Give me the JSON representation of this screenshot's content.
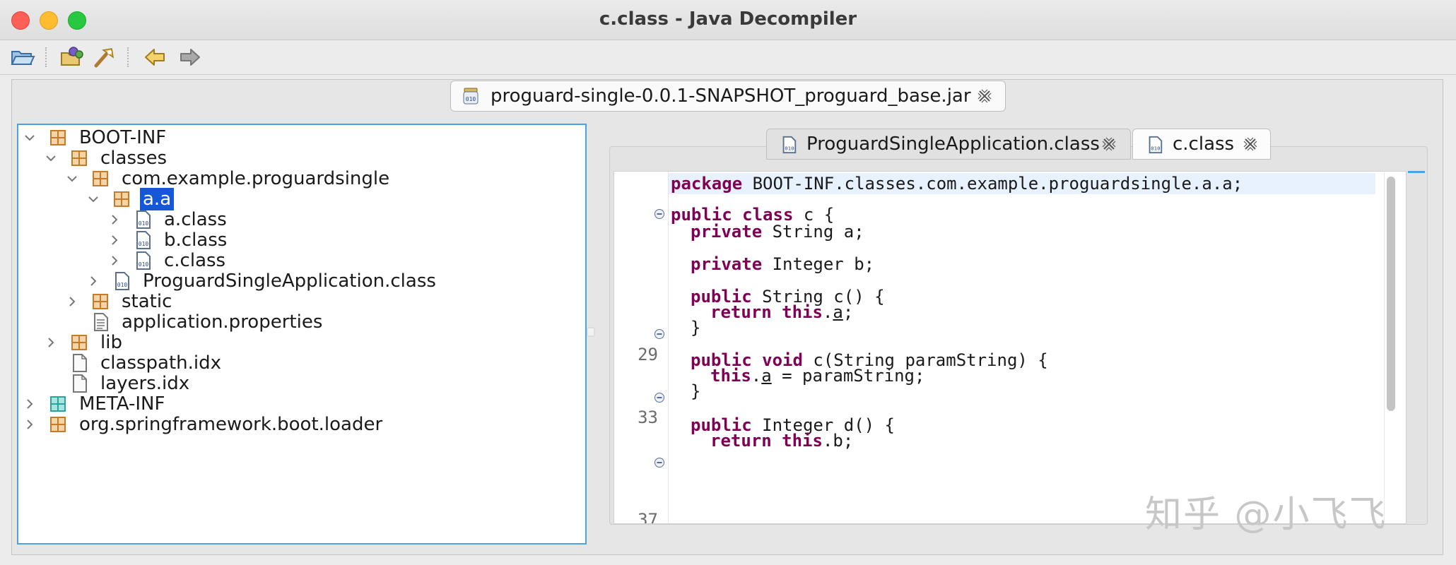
{
  "window": {
    "title": "c.class - Java Decompiler"
  },
  "toolbar": {
    "buttons": [
      {
        "icon": "open-file-icon"
      },
      {
        "icon": "open-type-icon"
      },
      {
        "icon": "search-icon"
      },
      {
        "icon": "back-arrow-icon"
      },
      {
        "icon": "forward-arrow-icon"
      }
    ]
  },
  "jar_tab": {
    "label": "proguard-single-0.0.1-SNAPSHOT_proguard_base.jar",
    "icon": "jar-icon"
  },
  "tree": {
    "nodes": [
      {
        "label": "BOOT-INF",
        "icon": "package-icon",
        "expanded": true
      },
      {
        "label": "classes",
        "icon": "package-icon",
        "expanded": true
      },
      {
        "label": "com.example.proguardsingle",
        "icon": "package-icon",
        "expanded": true
      },
      {
        "label": "a.a",
        "icon": "package-icon",
        "expanded": true,
        "selected": true
      },
      {
        "label": "a.class",
        "icon": "class-file-icon",
        "expanded": false
      },
      {
        "label": "b.class",
        "icon": "class-file-icon",
        "expanded": false
      },
      {
        "label": "c.class",
        "icon": "class-file-icon",
        "expanded": false
      },
      {
        "label": "ProguardSingleApplication.class",
        "icon": "class-file-icon",
        "expanded": false
      },
      {
        "label": "static",
        "icon": "package-icon",
        "expanded": false
      },
      {
        "label": "application.properties",
        "icon": "text-file-icon"
      },
      {
        "label": "lib",
        "icon": "package-icon",
        "expanded": false
      },
      {
        "label": "classpath.idx",
        "icon": "file-icon"
      },
      {
        "label": "layers.idx",
        "icon": "file-icon"
      },
      {
        "label": "META-INF",
        "icon": "meta-package-icon",
        "expanded": false
      },
      {
        "label": "org.springframework.boot.loader",
        "icon": "package-icon",
        "expanded": false
      }
    ]
  },
  "editor_tabs": [
    {
      "label": "ProguardSingleApplication.class",
      "active": false
    },
    {
      "label": "c.class",
      "active": true
    }
  ],
  "code": {
    "line_numbers": [
      "29",
      "33",
      "37"
    ],
    "lines": [
      {
        "kw": "package",
        "text": " BOOT-INF.classes.com.example.proguardsingle.a.a;"
      },
      {
        "kw": "public class",
        "text": " c {"
      },
      {
        "kw": "private",
        "text": " String a;"
      },
      {
        "kw": "private",
        "text": " Integer b;"
      },
      {
        "kw": "public",
        "text": " String c() {"
      },
      {
        "kw": "return this",
        "text": ".",
        "ul": "a",
        "tail": ";"
      },
      {
        "text": "}"
      },
      {
        "kw": "public void",
        "text": " c(String paramString) {"
      },
      {
        "kw": "this",
        "text": ".",
        "ul": "a",
        "tail": " = paramString;"
      },
      {
        "text": "}"
      },
      {
        "kw": "public",
        "text": " Integer d() {"
      },
      {
        "kw": "return this",
        "text": ".b;"
      }
    ]
  },
  "watermark": "知乎 @小飞飞",
  "colors": {
    "selection": "#1458d8",
    "keyword": "#7f0055",
    "focus_border": "#4aa3e6",
    "package_icon": "#c77a28"
  }
}
